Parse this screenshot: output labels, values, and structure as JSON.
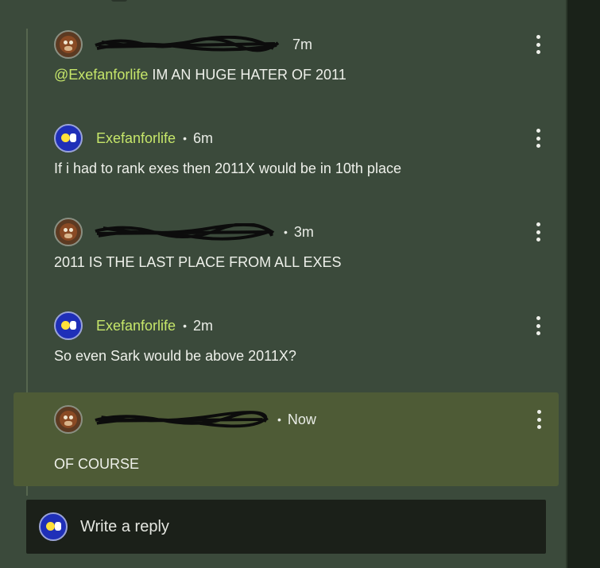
{
  "comments": [
    {
      "author": "",
      "author_redacted": true,
      "avatar": "bear-avatar",
      "time": "7m",
      "body_mention": "@Exefanforlife",
      "body": " IM AN HUGE HATER OF 2011"
    },
    {
      "author": "Exefanforlife",
      "author_redacted": false,
      "avatar": "blue-smiley-avatar",
      "time": "6m",
      "body": "If i had to rank exes then 2011X would be in 10th place"
    },
    {
      "author": "",
      "author_redacted": true,
      "avatar": "bear-avatar",
      "time": "3m",
      "body": "2011 IS THE LAST PLACE FROM ALL EXES"
    },
    {
      "author": "Exefanforlife",
      "author_redacted": false,
      "avatar": "blue-smiley-avatar",
      "time": "2m",
      "body": "So even Sark would be above 2011X?"
    },
    {
      "author": "",
      "author_redacted": true,
      "avatar": "bear-avatar",
      "time": "Now",
      "body": "OF COURSE",
      "highlighted": true
    }
  ],
  "separator": "•",
  "reply": {
    "placeholder": "Write a reply",
    "avatar": "blue-smiley-avatar"
  },
  "icons": {
    "more": "more-vertical-icon"
  },
  "colors": {
    "background": "#3b4a3b",
    "author": "#c6e66a",
    "highlight": "#4e5b36",
    "reply_box": "#1b2019"
  }
}
